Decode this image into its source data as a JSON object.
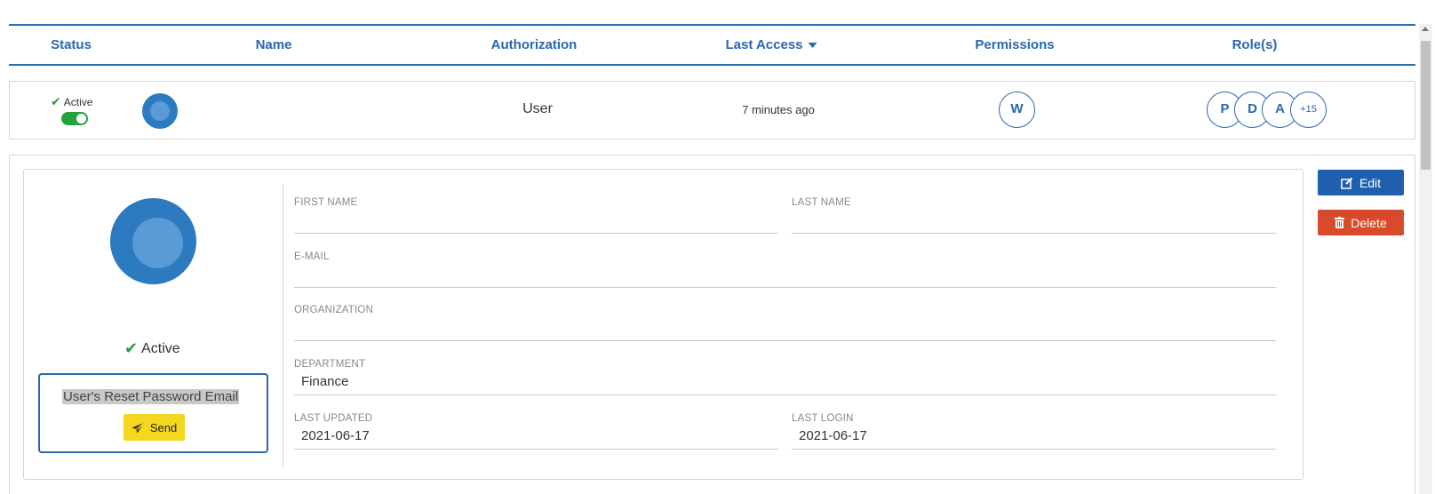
{
  "table": {
    "columns": {
      "status": "Status",
      "name": "Name",
      "authorization": "Authorization",
      "last_access": "Last Access",
      "permissions": "Permissions",
      "roles": "Role(s)"
    },
    "sort_column": "last_access",
    "sort_direction": "descending"
  },
  "row": {
    "status_label": "Active",
    "toggle_on": true,
    "name": "",
    "authorization": "User",
    "last_access": "7 minutes ago",
    "permissions": [
      "W"
    ],
    "roles": [
      "P",
      "D",
      "A"
    ],
    "roles_more": "+15"
  },
  "detail": {
    "status_label": "Active",
    "reset_password_label": "User's Reset Password Email",
    "send_label": "Send",
    "fields": {
      "first_name_label": "FIRST NAME",
      "first_name_value": "",
      "last_name_label": "LAST NAME",
      "last_name_value": "",
      "email_label": "E-MAIL",
      "email_value": "",
      "organization_label": "ORGANIZATION",
      "organization_value": "",
      "department_label": "DEPARTMENT",
      "department_value": "Finance",
      "last_updated_label": "LAST UPDATED",
      "last_updated_value": "2021-06-17",
      "last_login_label": "LAST LOGIN",
      "last_login_value": "2021-06-17"
    },
    "edit_label": "Edit",
    "delete_label": "Delete"
  },
  "colors": {
    "accent": "#2a67b1",
    "success": "#25a23a",
    "edit": "#1f5fae",
    "delete": "#d84a2c",
    "send": "#f3d81f",
    "avatar": "#2c7abf"
  },
  "icons": {
    "status": "check-icon",
    "sort": "caret-down-icon",
    "send": "paper-plane-icon",
    "edit": "edit-icon",
    "delete": "trash-icon"
  }
}
